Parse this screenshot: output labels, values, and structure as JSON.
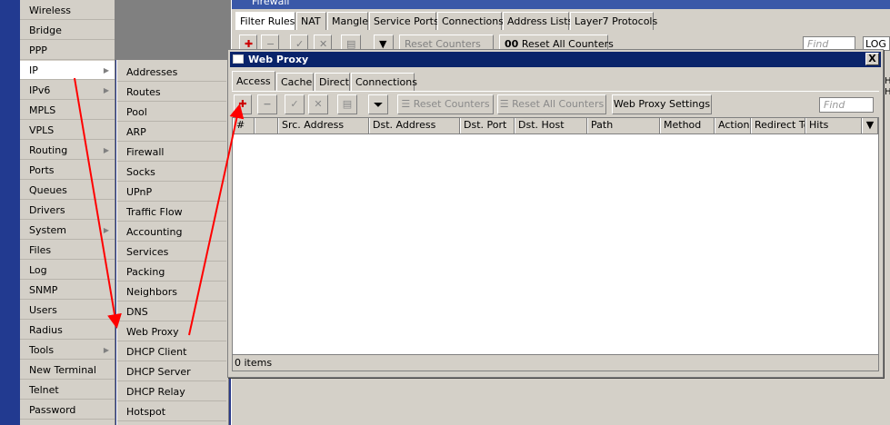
{
  "main_menu": {
    "items": [
      {
        "label": "Wireless",
        "has_sub": false
      },
      {
        "label": "Bridge",
        "has_sub": false
      },
      {
        "label": "PPP",
        "has_sub": false
      },
      {
        "label": "IP",
        "has_sub": true
      },
      {
        "label": "IPv6",
        "has_sub": true
      },
      {
        "label": "MPLS",
        "has_sub": false
      },
      {
        "label": "VPLS",
        "has_sub": false
      },
      {
        "label": "Routing",
        "has_sub": true
      },
      {
        "label": "Ports",
        "has_sub": false
      },
      {
        "label": "Queues",
        "has_sub": false
      },
      {
        "label": "Drivers",
        "has_sub": false
      },
      {
        "label": "System",
        "has_sub": true
      },
      {
        "label": "Files",
        "has_sub": false
      },
      {
        "label": "Log",
        "has_sub": false
      },
      {
        "label": "SNMP",
        "has_sub": false
      },
      {
        "label": "Users",
        "has_sub": false
      },
      {
        "label": "Radius",
        "has_sub": false
      },
      {
        "label": "Tools",
        "has_sub": true
      },
      {
        "label": "New Terminal",
        "has_sub": false
      },
      {
        "label": "Telnet",
        "has_sub": false
      },
      {
        "label": "Password",
        "has_sub": false
      }
    ]
  },
  "ip_submenu": {
    "items": [
      "Addresses",
      "Routes",
      "Pool",
      "ARP",
      "Firewall",
      "Socks",
      "UPnP",
      "Traffic Flow",
      "Accounting",
      "Services",
      "Packing",
      "Neighbors",
      "DNS",
      "Web Proxy",
      "DHCP Client",
      "DHCP Server",
      "DHCP Relay",
      "Hotspot"
    ]
  },
  "firewall_window": {
    "title": "Firewall",
    "tabs": [
      "Filter Rules",
      "NAT",
      "Mangle",
      "Service Ports",
      "Connections",
      "Address Lists",
      "Layer7 Protocols"
    ],
    "reset_counters": "Reset Counters",
    "reset_all_counters": "Reset All Counters",
    "all_prefix": "00",
    "find_placeholder": "Find",
    "log_value": "LOG"
  },
  "web_proxy_window": {
    "title": "Web Proxy",
    "close_label": "X",
    "tabs": [
      "Access",
      "Cache",
      "Direct",
      "Connections"
    ],
    "toolbar": {
      "reset_counters": "Reset Counters",
      "reset_all_counters": "Reset All Counters",
      "settings": "Web Proxy Settings",
      "find_placeholder": "Find"
    },
    "columns": [
      "#",
      "",
      "Src. Address",
      "Dst. Address",
      "Dst. Port",
      "Dst. Host",
      "Path",
      "Method",
      "Action",
      "Redirect To",
      "Hits"
    ],
    "status": "0 items"
  },
  "edge_text": {
    "h1": "H",
    "h2": "H"
  },
  "colors": {
    "title_active": "#0a246a",
    "title_inactive": "#3a58a8",
    "annotation_arrow": "#ff0000",
    "add_icon": "#cc0000"
  }
}
